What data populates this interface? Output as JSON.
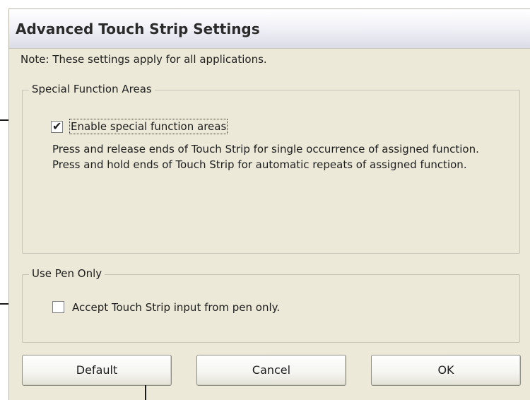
{
  "dialog": {
    "title": "Advanced Touch Strip Settings",
    "note": "Note: These settings apply for all applications."
  },
  "special_function_areas": {
    "group_label": "Special Function Areas",
    "checkbox_label": "Enable special function areas",
    "checked": true,
    "description": "Press and release ends of Touch Strip for single occurrence of assigned function. Press and hold ends of Touch Strip for automatic repeats of assigned function."
  },
  "use_pen_only": {
    "group_label": "Use Pen Only",
    "checkbox_label": "Accept Touch Strip input from pen only.",
    "checked": false
  },
  "buttons": {
    "default": "Default",
    "cancel": "Cancel",
    "ok": "OK"
  }
}
